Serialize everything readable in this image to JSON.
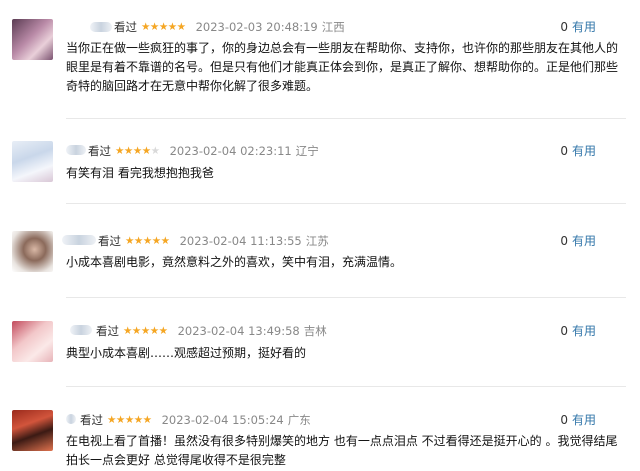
{
  "reviews": [
    {
      "status": "看过",
      "rating": 5,
      "stars": "★★★★★",
      "date": "2023-02-03 20:48:19",
      "region": "江西",
      "useful_count": "0",
      "useful_label": "有用",
      "content": "当你正在做一些疯狂的事了，你的身边总会有一些朋友在帮助你、支持你，也许你的那些朋友在其他人的眼里是有着不靠谱的名号。但是只有他们才能真正体会到你，是真正了解你、想帮助你的。正是他们那些奇特的脑回路才在无意中帮你化解了很多难题。"
    },
    {
      "status": "看过",
      "rating": 4,
      "stars": "★★★★",
      "date": "2023-02-04 02:23:11",
      "region": "辽宁",
      "useful_count": "0",
      "useful_label": "有用",
      "content": "有笑有泪 看完我想抱抱我爸"
    },
    {
      "status": "看过",
      "rating": 5,
      "stars": "★★★★★",
      "date": "2023-02-04 11:13:55",
      "region": "江苏",
      "useful_count": "0",
      "useful_label": "有用",
      "content": "小成本喜剧电影，竟然意料之外的喜欢，笑中有泪，充满温情。"
    },
    {
      "status": "看过",
      "rating": 5,
      "stars": "★★★★★",
      "date": "2023-02-04 13:49:58",
      "region": "吉林",
      "useful_count": "0",
      "useful_label": "有用",
      "content": "典型小成本喜剧……观感超过预期，挺好看的"
    },
    {
      "status": "看过",
      "rating": 5,
      "stars": "★★★★★",
      "date": "2023-02-04 15:05:24",
      "region": "广东",
      "useful_count": "0",
      "useful_label": "有用",
      "content": "在电视上看了首播！虽然没有很多特别爆笑的地方 也有一点点泪点 不过看得还是挺开心的 。我觉得结尾拍长一点会更好 总觉得尾收得不是很完整"
    }
  ]
}
